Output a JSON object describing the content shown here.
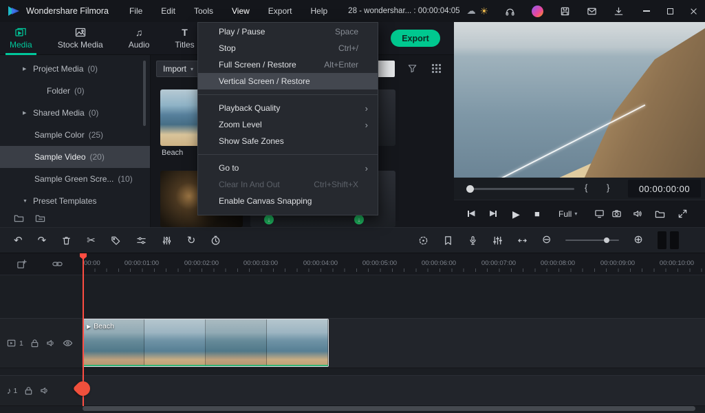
{
  "titlebar": {
    "app_title": "Wondershare Filmora",
    "menu_items": [
      "File",
      "Edit",
      "Tools",
      "View",
      "Export",
      "Help"
    ],
    "project_label": "28 - wondershar... : 00:00:04:05"
  },
  "tabbar": {
    "tabs": [
      "Media",
      "Stock Media",
      "Audio",
      "Titles"
    ],
    "export_button": "Export"
  },
  "sidebar": {
    "items": [
      {
        "label": "Project Media",
        "count": "(0)"
      },
      {
        "label": "Folder",
        "count": "(0)"
      },
      {
        "label": "Shared Media",
        "count": "(0)"
      },
      {
        "label": "Sample Color",
        "count": "(25)"
      },
      {
        "label": "Sample Video",
        "count": "(20)"
      },
      {
        "label": "Sample Green Scre...",
        "count": "(10)"
      },
      {
        "label": "Preset Templates",
        "count": ""
      }
    ]
  },
  "media_panel": {
    "import_button": "Import",
    "clip_labels": [
      "Beach"
    ]
  },
  "view_menu": {
    "items": [
      {
        "label": "Play / Pause",
        "shortcut": "Space"
      },
      {
        "label": "Stop",
        "shortcut": "Ctrl+/"
      },
      {
        "label": "Full Screen / Restore",
        "shortcut": "Alt+Enter"
      },
      {
        "label": "Vertical Screen / Restore",
        "shortcut": ""
      },
      {
        "label": "Playback Quality",
        "shortcut": ""
      },
      {
        "label": "Zoom Level",
        "shortcut": ""
      },
      {
        "label": "Show Safe Zones",
        "shortcut": ""
      },
      {
        "label": "Go to",
        "shortcut": ""
      },
      {
        "label": "Clear In And Out",
        "shortcut": "Ctrl+Shift+X"
      },
      {
        "label": "Enable Canvas Snapping",
        "shortcut": ""
      }
    ]
  },
  "preview": {
    "timecode": "00:00:00:00",
    "quality_selector": "Full",
    "mark_in": "{",
    "mark_out": "}"
  },
  "timeline": {
    "ruler_labels": [
      "00:00",
      "00:00:01:00",
      "00:00:02:00",
      "00:00:03:00",
      "00:00:04:00",
      "00:00:05:00",
      "00:00:06:00",
      "00:00:07:00",
      "00:00:08:00",
      "00:00:09:00",
      "00:00:10:00"
    ],
    "video_track_number": "1",
    "audio_track_number": "1",
    "clip_label": "Beach"
  },
  "colors": {
    "accent_teal": "#00c79b",
    "export_green": "#00c88f",
    "playhead_red": "#ff4d42",
    "menu_highlight": "#43474f",
    "download_badge_green": "#21c768"
  }
}
